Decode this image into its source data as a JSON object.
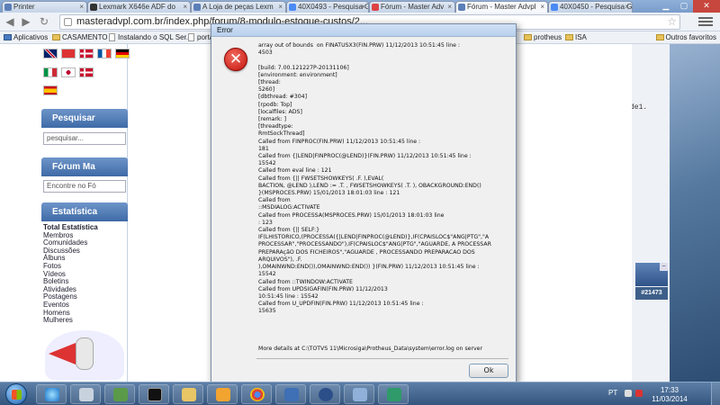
{
  "browser": {
    "tabs": [
      {
        "label": "Printer"
      },
      {
        "label": "Lexmark X646e ADF do"
      },
      {
        "label": "A Loja de peças Lexm"
      },
      {
        "label": "40X0493 - Pesquisa G"
      },
      {
        "label": "Fórum - Master Adv"
      },
      {
        "label": "Fórum - Master Advpl"
      },
      {
        "label": "40X0450 - Pesquisa G"
      }
    ],
    "url": "masteradvpl.com.br/index.php/forum/8-modulo-estoque-custos/2...",
    "bookmarks": [
      {
        "label": "Aplicativos"
      },
      {
        "label": "CASAMENTO"
      },
      {
        "label": "Instalando o SQL Ser..."
      },
      {
        "label": "porta"
      },
      {
        "label": "protheus"
      },
      {
        "label": "ISA"
      },
      {
        "label": "Outros favoritos"
      }
    ]
  },
  "sidebar": {
    "search_header": "Pesquisar",
    "search_placeholder": "pesquisar...",
    "forum_header": "Fórum Ma",
    "forum_input": "Encontre no Fó",
    "stats_header": "Estatística",
    "stats_title": "Total Estatística",
    "stats_items": [
      "Membros",
      "Comunidades",
      "Discussões",
      "Álbuns",
      "Fotos",
      "Vídeos",
      "Boletins",
      "Atividades",
      "Postagens",
      "Eventos",
      "Homens",
      "Mulheres"
    ]
  },
  "right_panel": {
    "behind_text": "de1.",
    "thread_badge": "#21473"
  },
  "dialog": {
    "title": "Error",
    "message": "array out of bounds  on FINATUSX3(FIN.PRW) 11/12/2013 10:51:45 line :\n4503\n\n[build: 7.00.121227P-20131106]\n[environment: environment]\n[thread:\n5260]\n[dbthread: #304]\n[rpodb: Top]\n[localfiles: ADS]\n[remark: ]\n[threadtype:\nRmtSockThread]\nCalled from FINPROC(FIN.PRW) 11/12/2013 10:51:45 line :\n181\nCalled from {|LEND|FINPROC(@LEND)}(FIN.PRW) 11/12/2013 10:51:45 line :\n15542\nCalled from eval line : 121\nCalled from {|| FWSETSHOWKEYS( .F. ),EVAL(\nBACTION, @LEND ),LEND := .T. , FWSETSHOWKEYS( .T. ), OBACKGROUND:END()\n}(MSPROCES.PRW) 15/01/2013 18:01:03 line : 121\nCalled from\n::MSDIALOG:ACTIVATE\nCalled from PROCESSA(MSPROCES.PRW) 15/01/2013 18:01:03 line\n: 123\nCalled from {|| SELF:}\nIF(LHISTORICO,(PROCESSA({|LEND|FINPROC(@LEND)},IF(CPAISLOC$\"ANG|PTG\",\"A\nPROCESSAR\",\"PROCESSANDO\"),IF(CPAISLOC$\"ANG|PTG\",\"AGUARDE, A PROCESSAR\nPREPARAçãO DOS FICHEIROS\",\"AGUARDE , PROCESSANDO PREPARACAO DOS ARQUIVOS\"), .F.\n),OMAINWND:END()),OMAINWND:END()) }(FIN.PRW) 11/12/2013 10:51:45 line :\n15542\nCalled from ::TWINDOW:ACTIVATE\nCalled from UPDSIGAFIN(FIN.PRW) 11/12/2013\n10:51:45 line : 15542\nCalled from U_UPDFIN(FIN.PRW) 11/12/2013 10:51:45 line :\n15635",
    "details": "More details at C:\\TOTVS 11\\Microsiga\\Protheus_Data\\system\\error.log on server",
    "ok_label": "Ok"
  },
  "taskbar": {
    "lang": "PT",
    "time": "17:33",
    "date": "11/03/2014"
  }
}
